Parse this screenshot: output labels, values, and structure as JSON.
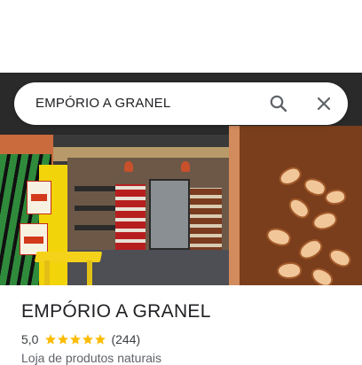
{
  "search": {
    "query": "EMPÓRIO A GRANEL"
  },
  "place": {
    "name": "EMPÓRIO A GRANEL",
    "rating": "5,0",
    "stars": 5,
    "review_count": "(244)",
    "category": "Loja de produtos naturais"
  },
  "icons": {
    "search": "search-icon",
    "close": "close-icon",
    "star": "star-icon"
  },
  "colors": {
    "star": "#fbbc04",
    "icon": "#5f6368",
    "title": "#202124"
  }
}
